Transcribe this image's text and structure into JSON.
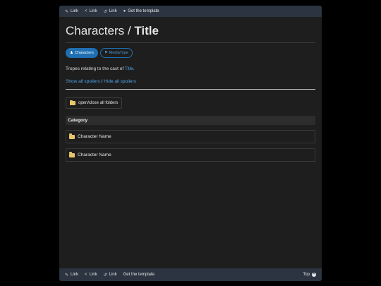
{
  "nav": {
    "items": [
      {
        "icon": "pencil-icon",
        "glyph": "✎",
        "label": "Link"
      },
      {
        "icon": "share-icon",
        "glyph": "<",
        "label": "Link"
      },
      {
        "icon": "history-icon",
        "glyph": "↺",
        "label": "Link"
      },
      {
        "icon": "speech-bubble-icon",
        "glyph": "●",
        "label": "Get the template"
      }
    ],
    "bottom_items": [
      {
        "icon": "pencil-icon",
        "glyph": "✎",
        "label": "Link"
      },
      {
        "icon": "share-icon",
        "glyph": "<",
        "label": "Link"
      },
      {
        "icon": "history-icon",
        "glyph": "↺",
        "label": "Link"
      },
      {
        "label": "Get the template"
      }
    ],
    "top_label": "Top",
    "top_glyph": "^"
  },
  "title": {
    "prefix": "Characters / ",
    "name": "Title"
  },
  "pills": {
    "active_label": "Characters",
    "active_glyph": "♟",
    "outline_label": "MediaType",
    "outline_glyph": "⚑"
  },
  "description": {
    "text": "Tropes relating to the cast of ",
    "link": "Title",
    "end": "."
  },
  "spoilers": {
    "show": "Show all spoilers",
    "divider": " / ",
    "hide": "Hide all spoilers"
  },
  "folders_button": "open/close all folders",
  "category": "Category",
  "characters": [
    "Character Name",
    "Character Name"
  ],
  "colors": {
    "accent": "#1f6fb2",
    "link": "#4ea4e8",
    "navbar": "#2b3440",
    "background": "#1e1e1e",
    "folder": "#e8c66b"
  }
}
